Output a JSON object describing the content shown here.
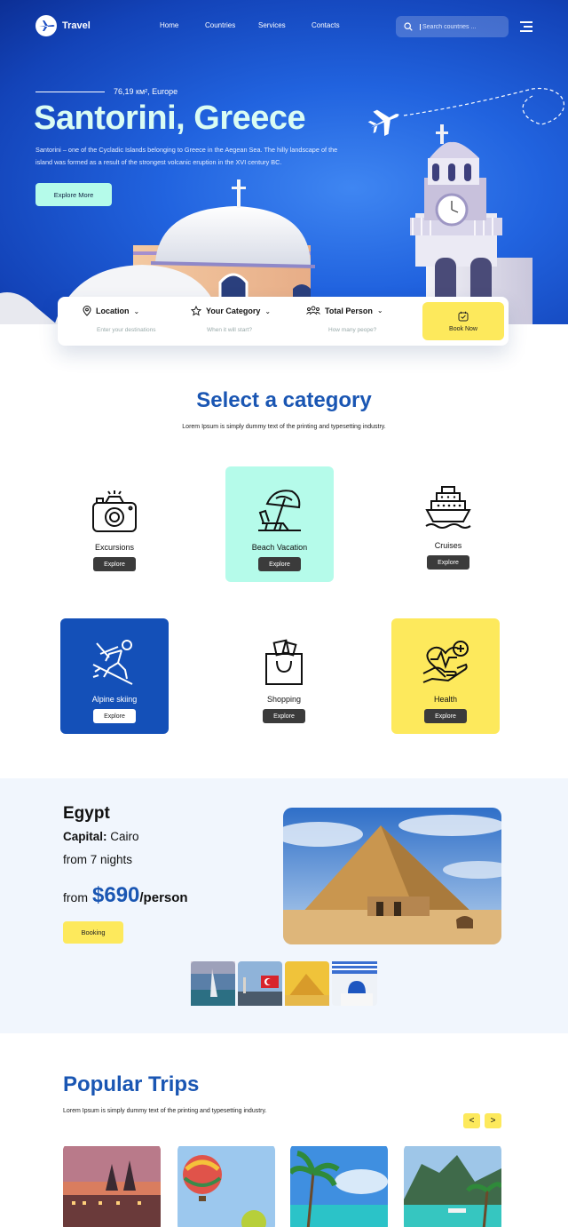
{
  "header": {
    "brand": "Travel",
    "nav": [
      "Home",
      "Countries",
      "Services",
      "Contacts"
    ],
    "search_placeholder": "Search countries ..."
  },
  "hero": {
    "area": "76,19 км², Europe",
    "title": "Santorini, Greece",
    "description": "Santorini – one of the Cycladic Islands belonging to Greece in the Aegean Sea. The hilly landscape of the island was formed as a result of the strongest volcanic eruption in the XVI century BC.",
    "cta": "Explore More"
  },
  "booking": {
    "fields": [
      {
        "label": "Location",
        "hint": "Enter your destinations"
      },
      {
        "label": "Your Category",
        "hint": "When it will start?"
      },
      {
        "label": "Total Person",
        "hint": "How many peope?"
      }
    ],
    "cta": "Book Now"
  },
  "categories": {
    "title": "Select a category",
    "subtitle": "Lorem Ipsum is simply dummy text of the printing and typesetting industry.",
    "explore_label": "Explore",
    "items": [
      {
        "name": "Excursions",
        "icon": "camera-icon"
      },
      {
        "name": "Beach Vacation",
        "icon": "beach-umbrella-icon"
      },
      {
        "name": "Cruises",
        "icon": "cruise-ship-icon"
      },
      {
        "name": "Alpine skiing",
        "icon": "skier-icon"
      },
      {
        "name": "Shopping",
        "icon": "shopping-bag-icon"
      },
      {
        "name": "Health",
        "icon": "health-heart-icon"
      }
    ]
  },
  "destination": {
    "country": "Egypt",
    "capital_label": "Capital:",
    "capital": "Cairo",
    "nights": "from 7 nights",
    "price_prefix": "from",
    "price": "$690",
    "price_suffix": "/person",
    "cta": "Booking"
  },
  "popular": {
    "title": "Popular Trips",
    "subtitle": "Lorem Ipsum is simply dummy text of the printing and typesetting industry.",
    "prev": "<",
    "next": ">"
  },
  "colors": {
    "primary": "#1a56b3",
    "accent_yellow": "#fde95c",
    "accent_mint": "#b5fbea",
    "hero_blue": "#2163df"
  }
}
